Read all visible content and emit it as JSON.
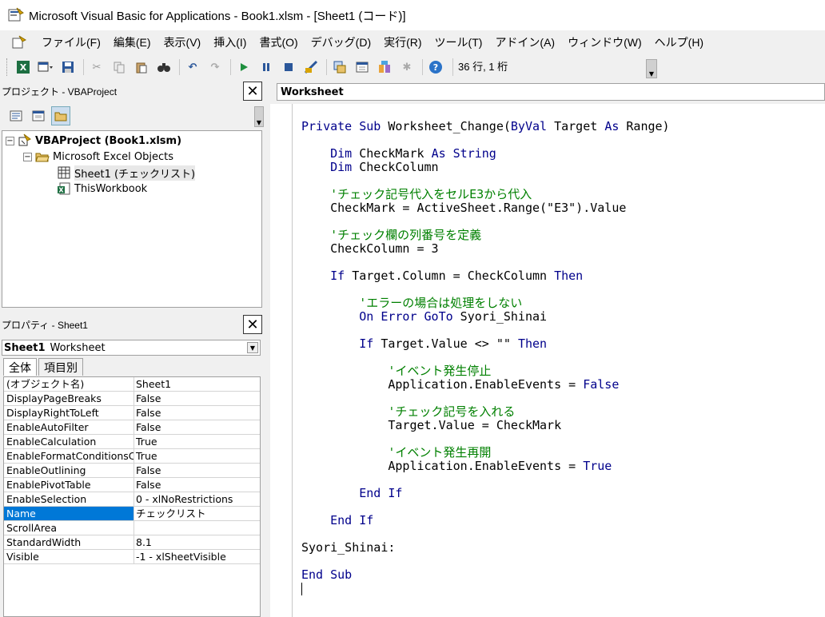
{
  "window": {
    "title": "Microsoft Visual Basic for Applications - Book1.xlsm - [Sheet1 (コード)]"
  },
  "menu": {
    "items": [
      "ファイル(F)",
      "編集(E)",
      "表示(V)",
      "挿入(I)",
      "書式(O)",
      "デバッグ(D)",
      "実行(R)",
      "ツール(T)",
      "アドイン(A)",
      "ウィンドウ(W)",
      "ヘルプ(H)"
    ]
  },
  "toolbar": {
    "status": "36 行, 1 桁"
  },
  "project_pane": {
    "title": "プロジェクト - VBAProject",
    "tree": {
      "root": "VBAProject (Book1.xlsm)",
      "folder": "Microsoft Excel Objects",
      "sheet": "Sheet1 (チェックリスト)",
      "workbook": "ThisWorkbook"
    }
  },
  "properties_pane": {
    "title": "プロパティ - Sheet1",
    "object_name": "Sheet1",
    "object_type": "Worksheet",
    "tabs": [
      "全体",
      "項目別"
    ],
    "rows": [
      {
        "name": "(オブジェクト名)",
        "value": "Sheet1"
      },
      {
        "name": "DisplayPageBreaks",
        "value": "False"
      },
      {
        "name": "DisplayRightToLeft",
        "value": "False"
      },
      {
        "name": "EnableAutoFilter",
        "value": "False"
      },
      {
        "name": "EnableCalculation",
        "value": "True"
      },
      {
        "name": "EnableFormatConditionsCalculation",
        "value": "True"
      },
      {
        "name": "EnableOutlining",
        "value": "False"
      },
      {
        "name": "EnablePivotTable",
        "value": "False"
      },
      {
        "name": "EnableSelection",
        "value": "0 - xlNoRestrictions"
      },
      {
        "name": "Name",
        "value": "チェックリスト"
      },
      {
        "name": "ScrollArea",
        "value": ""
      },
      {
        "name": "StandardWidth",
        "value": "8.1"
      },
      {
        "name": "Visible",
        "value": "-1 - xlSheetVisible"
      }
    ],
    "selected_row": "Name"
  },
  "code_window": {
    "object_combo": "Worksheet",
    "lines": [
      [
        {
          "t": "Private Sub ",
          "c": "kw"
        },
        {
          "t": "Worksheet_Change(",
          "c": ""
        },
        {
          "t": "ByVal",
          "c": "kw"
        },
        {
          "t": " Target ",
          "c": ""
        },
        {
          "t": "As",
          "c": "kw"
        },
        {
          "t": " Range)",
          "c": ""
        }
      ],
      [],
      [
        {
          "t": "    Dim",
          "c": "kw"
        },
        {
          "t": " CheckMark ",
          "c": ""
        },
        {
          "t": "As String",
          "c": "kw"
        }
      ],
      [
        {
          "t": "    Dim",
          "c": "kw"
        },
        {
          "t": " CheckColumn",
          "c": ""
        }
      ],
      [],
      [
        {
          "t": "    'チェック記号代入をセルE3から代入",
          "c": "cm"
        }
      ],
      [
        {
          "t": "    CheckMark = ActiveSheet.Range(\"E3\").Value",
          "c": ""
        }
      ],
      [],
      [
        {
          "t": "    'チェック欄の列番号を定義",
          "c": "cm"
        }
      ],
      [
        {
          "t": "    CheckColumn = 3",
          "c": ""
        }
      ],
      [],
      [
        {
          "t": "    If",
          "c": "kw"
        },
        {
          "t": " Target.Column = CheckColumn ",
          "c": ""
        },
        {
          "t": "Then",
          "c": "kw"
        }
      ],
      [],
      [
        {
          "t": "        'エラーの場合は処理をしない",
          "c": "cm"
        }
      ],
      [
        {
          "t": "        On Error GoTo",
          "c": "kw"
        },
        {
          "t": " Syori_Shinai",
          "c": ""
        }
      ],
      [],
      [
        {
          "t": "        If",
          "c": "kw"
        },
        {
          "t": " Target.Value <> \"\" ",
          "c": ""
        },
        {
          "t": "Then",
          "c": "kw"
        }
      ],
      [],
      [
        {
          "t": "            'イベント発生停止",
          "c": "cm"
        }
      ],
      [
        {
          "t": "            Application.EnableEvents = ",
          "c": ""
        },
        {
          "t": "False",
          "c": "kw"
        }
      ],
      [],
      [
        {
          "t": "            'チェック記号を入れる",
          "c": "cm"
        }
      ],
      [
        {
          "t": "            Target.Value = CheckMark",
          "c": ""
        }
      ],
      [],
      [
        {
          "t": "            'イベント発生再開",
          "c": "cm"
        }
      ],
      [
        {
          "t": "            Application.EnableEvents = ",
          "c": ""
        },
        {
          "t": "True",
          "c": "kw"
        }
      ],
      [],
      [
        {
          "t": "        End If",
          "c": "kw"
        }
      ],
      [],
      [
        {
          "t": "    End If",
          "c": "kw"
        }
      ],
      [],
      [
        {
          "t": "Syori_Shinai:",
          "c": ""
        }
      ],
      [],
      [
        {
          "t": "End Sub",
          "c": "kw"
        }
      ]
    ]
  },
  "colors": {
    "keyword": "#00008b",
    "comment": "#008000",
    "selection": "#0078d7"
  },
  "icons": {
    "app": "vba-app-icon",
    "excel": "excel-icon",
    "save": "save-icon",
    "run": "run-icon"
  }
}
